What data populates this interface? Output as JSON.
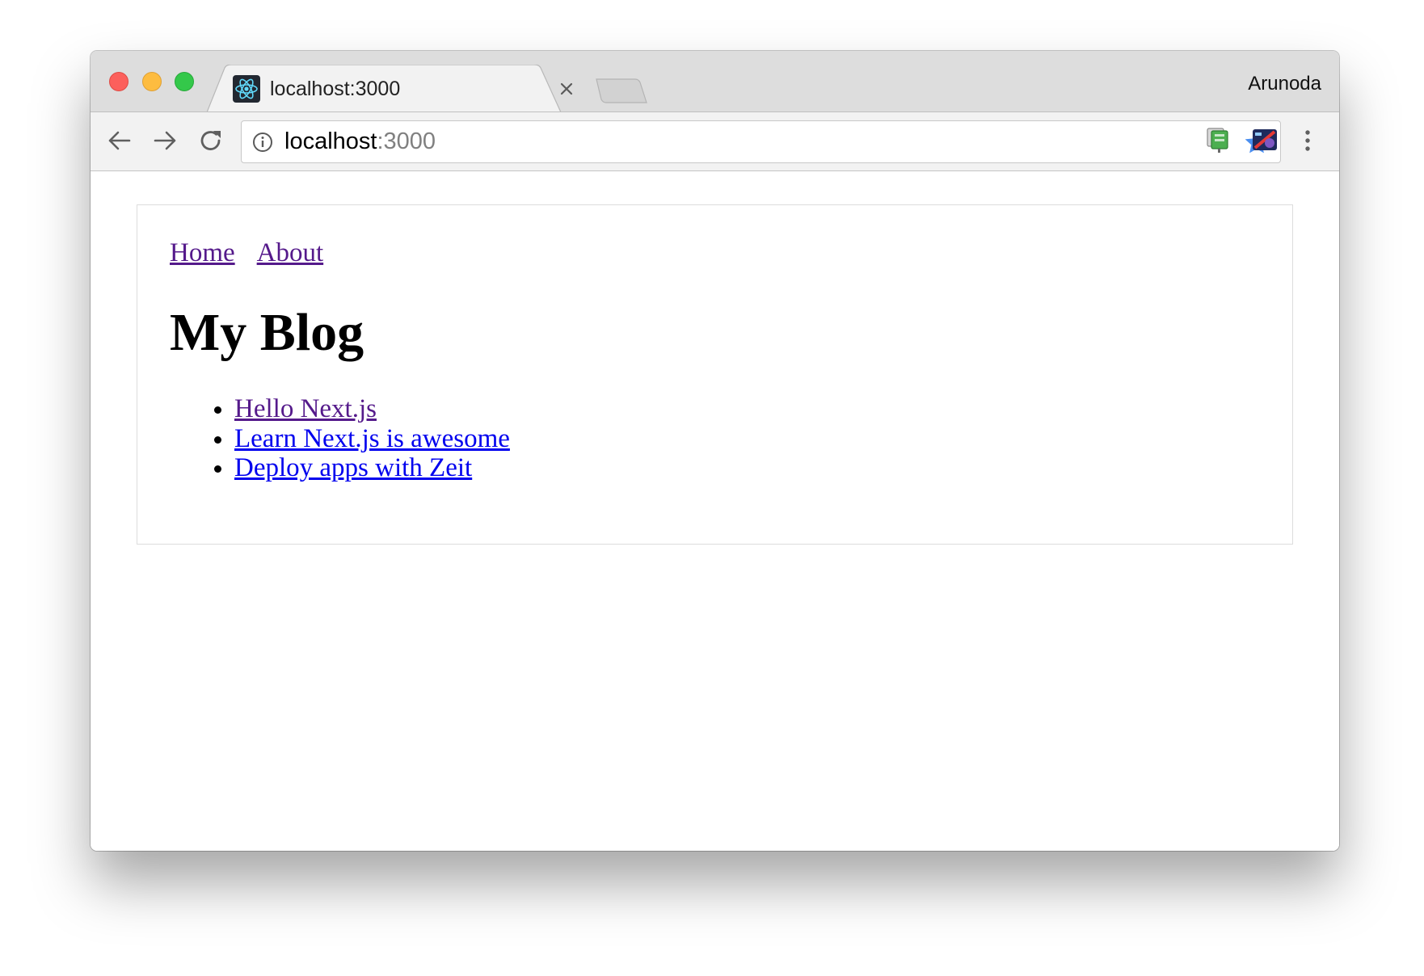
{
  "window": {
    "tab": {
      "title": "localhost:3000",
      "favicon": "react-icon"
    },
    "profile_name": "Arunoda"
  },
  "toolbar": {
    "url_host": "localhost",
    "url_port": ":3000",
    "icons": [
      "back-icon",
      "forward-icon",
      "reload-icon",
      "info-icon",
      "star-icon",
      "extension-icon",
      "extension-icon",
      "menu-icon"
    ]
  },
  "page": {
    "nav": [
      {
        "label": "Home"
      },
      {
        "label": "About"
      }
    ],
    "title": "My Blog",
    "posts": [
      {
        "label": "Hello Next.js",
        "visited": true
      },
      {
        "label": "Learn Next.js is awesome",
        "visited": false
      },
      {
        "label": "Deploy apps with Zeit",
        "visited": false
      }
    ]
  },
  "colors": {
    "link": "#0000ee",
    "visited_link": "#551a8b",
    "star": "#4a8ef0",
    "traffic_close": "#fc605c",
    "traffic_minimize": "#fdbc40",
    "traffic_maximize": "#34c84a"
  }
}
